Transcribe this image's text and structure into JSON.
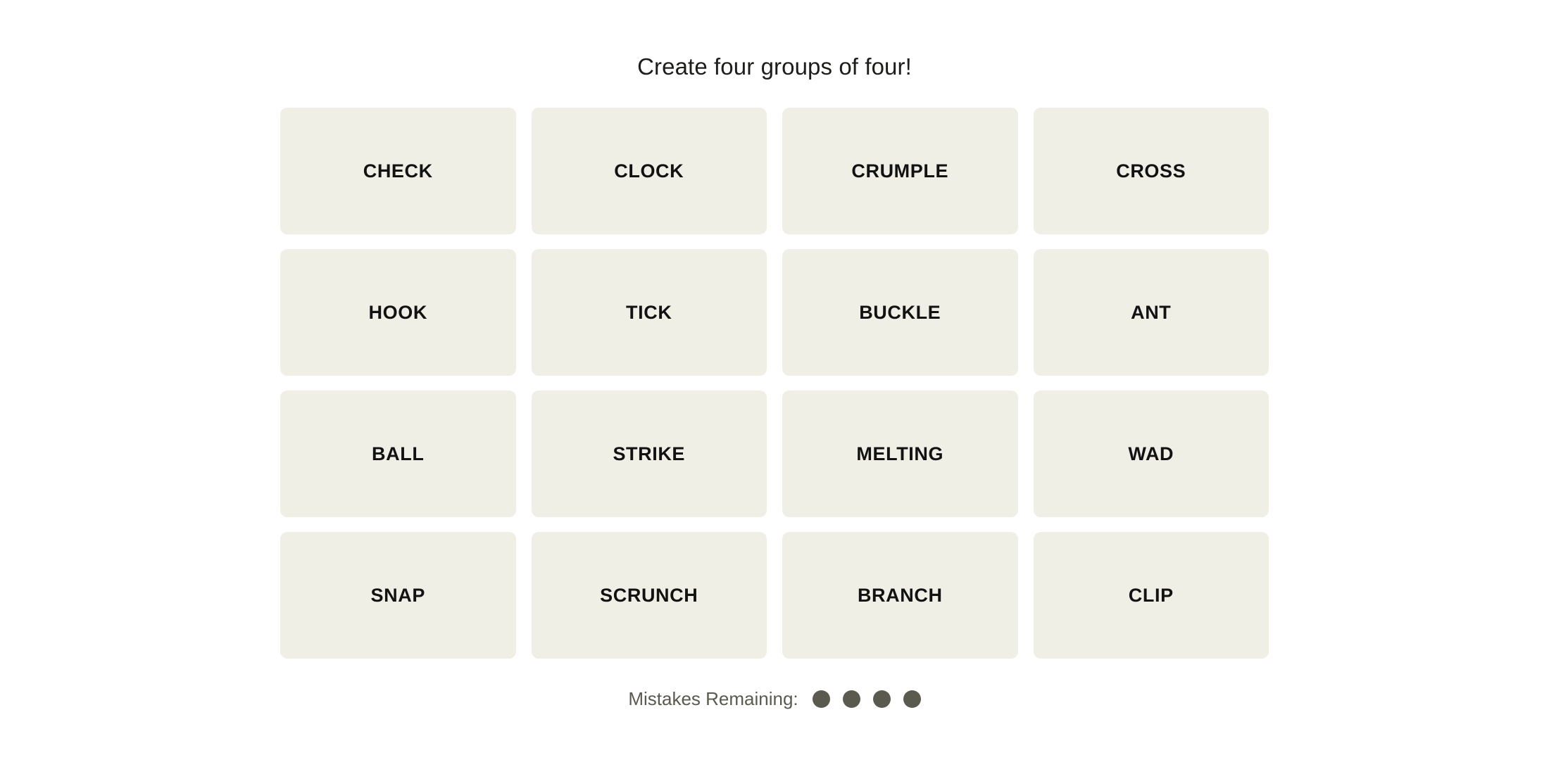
{
  "header": {
    "title": "Create four groups of four!"
  },
  "board": {
    "rows": 4,
    "columns": 4,
    "tile_background": "#EFEFE6",
    "tile_text_color": "#121212",
    "tiles": [
      {
        "label": "CHECK"
      },
      {
        "label": "CLOCK"
      },
      {
        "label": "CRUMPLE"
      },
      {
        "label": "CROSS"
      },
      {
        "label": "HOOK"
      },
      {
        "label": "TICK"
      },
      {
        "label": "BUCKLE"
      },
      {
        "label": "ANT"
      },
      {
        "label": "BALL"
      },
      {
        "label": "STRIKE"
      },
      {
        "label": "MELTING"
      },
      {
        "label": "WAD"
      },
      {
        "label": "SNAP"
      },
      {
        "label": "SCRUNCH"
      },
      {
        "label": "BRANCH"
      },
      {
        "label": "CLIP"
      }
    ]
  },
  "footer": {
    "mistakes_label": "Mistakes Remaining:",
    "mistakes_remaining": 4,
    "dot_color": "#5A5A4E",
    "dots": [
      {
        "name": "mistake-dot-1"
      },
      {
        "name": "mistake-dot-2"
      },
      {
        "name": "mistake-dot-3"
      },
      {
        "name": "mistake-dot-4"
      }
    ]
  }
}
